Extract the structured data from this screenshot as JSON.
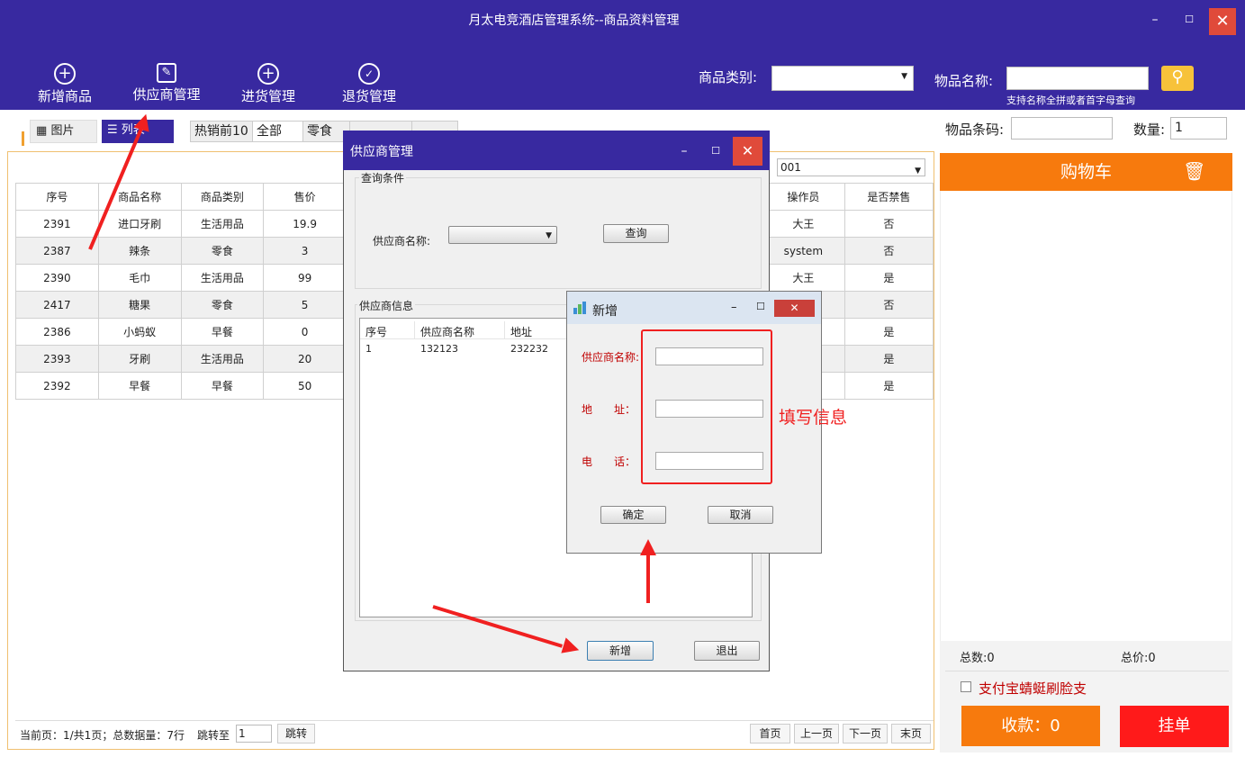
{
  "window": {
    "title": "月太电竞酒店管理系统--商品资料管理",
    "close": "✕",
    "minimize": "–",
    "maximize": "☐"
  },
  "toolbar": [
    {
      "label": "新增商品",
      "icon": "plus-circle-icon"
    },
    {
      "label": "供应商管理",
      "icon": "edit-icon"
    },
    {
      "label": "进货管理",
      "icon": "plus-circle-icon"
    },
    {
      "label": "退货管理",
      "icon": "return-icon"
    }
  ],
  "search": {
    "category_label": "商品类别:",
    "name_label": "物品名称:",
    "hint": "支持名称全拼或者首字母查询",
    "barcode_label": "物品条码:",
    "qty_label": "数量:",
    "qty_value": "1"
  },
  "view": {
    "image": "图片",
    "list": "列表"
  },
  "tabs": [
    "热销前10",
    "全部",
    "零食"
  ],
  "operator_select": "001",
  "table": {
    "headers": [
      "序号",
      "商品名称",
      "商品类别",
      "售价"
    ],
    "right_headers": [
      "操作员",
      "是否禁售"
    ],
    "rows": [
      [
        "2391",
        "进口牙刷",
        "生活用品",
        "19.9",
        "大王",
        "否"
      ],
      [
        "2387",
        "辣条",
        "零食",
        "3",
        "system",
        "否"
      ],
      [
        "2390",
        "毛巾",
        "生活用品",
        "99",
        "大王",
        "是"
      ],
      [
        "2417",
        "糖果",
        "零食",
        "5",
        "",
        "否"
      ],
      [
        "2386",
        "小蚂蚁",
        "早餐",
        "0",
        "",
        "是"
      ],
      [
        "2393",
        "牙刷",
        "生活用品",
        "20",
        "",
        "是"
      ],
      [
        "2392",
        "早餐",
        "早餐",
        "50",
        "",
        "是"
      ]
    ]
  },
  "pager": {
    "info": "当前页：1/共1页；总数据量：7行",
    "jump_label": "跳转至",
    "jump_value": "1",
    "jump_btn": "跳转",
    "first": "首页",
    "prev": "上一页",
    "next": "下一页",
    "last": "末页"
  },
  "cart": {
    "title": "购物车",
    "total_count": "总数:0",
    "total_price": "总价:0",
    "alipay": "支付宝蜻蜓刷脸支",
    "pay": "收款：0",
    "hold": "挂单"
  },
  "supplier_dialog": {
    "title": "供应商管理",
    "query_group": "查询条件",
    "name_label": "供应商名称:",
    "query_btn": "查询",
    "info_group": "供应商信息",
    "list_headers": [
      "序号",
      "供应商名称",
      "地址"
    ],
    "list_rows": [
      [
        "1",
        "132123",
        "232232"
      ]
    ],
    "add_btn": "新增",
    "exit_btn": "退出"
  },
  "add_dialog": {
    "title": "新增",
    "name_label": "供应商名称:",
    "address_label": "地　　址：",
    "phone_label": "电　　话：",
    "ok": "确定",
    "cancel": "取消"
  },
  "annotation": "填写信息",
  "colors": {
    "title_bar": "#3829a0",
    "cart_orange": "#f77a0d",
    "hold_red": "#ff1a1a",
    "annotation_red": "#f02020"
  }
}
